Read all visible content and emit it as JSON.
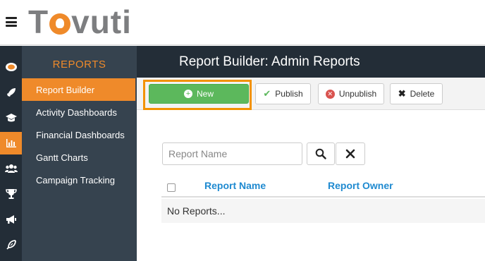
{
  "app": {
    "logo_text": "Tovuti",
    "brand_color": "#ef8a2a"
  },
  "icon_rail": [
    {
      "name": "home-icon",
      "active": false
    },
    {
      "name": "rocket-icon",
      "active": false
    },
    {
      "name": "graduation-cap-icon",
      "active": false
    },
    {
      "name": "bar-chart-icon",
      "active": true
    },
    {
      "name": "users-icon",
      "active": false
    },
    {
      "name": "trophy-icon",
      "active": false
    },
    {
      "name": "megaphone-icon",
      "active": false
    },
    {
      "name": "feather-icon",
      "active": false
    }
  ],
  "sidebar": {
    "title": "REPORTS",
    "items": [
      {
        "label": "Report Builder",
        "active": true
      },
      {
        "label": "Activity Dashboards",
        "active": false
      },
      {
        "label": "Financial Dashboards",
        "active": false
      },
      {
        "label": "Gantt Charts",
        "active": false
      },
      {
        "label": "Campaign Tracking",
        "active": false
      }
    ]
  },
  "header": {
    "title": "Report Builder: Admin Reports"
  },
  "toolbar": {
    "new_label": "New",
    "publish_label": "Publish",
    "unpublish_label": "Unpublish",
    "delete_label": "Delete"
  },
  "search": {
    "placeholder": "Report Name",
    "value": ""
  },
  "table": {
    "columns": [
      "Report Name",
      "Report Owner"
    ],
    "empty_text": "No Reports..."
  }
}
